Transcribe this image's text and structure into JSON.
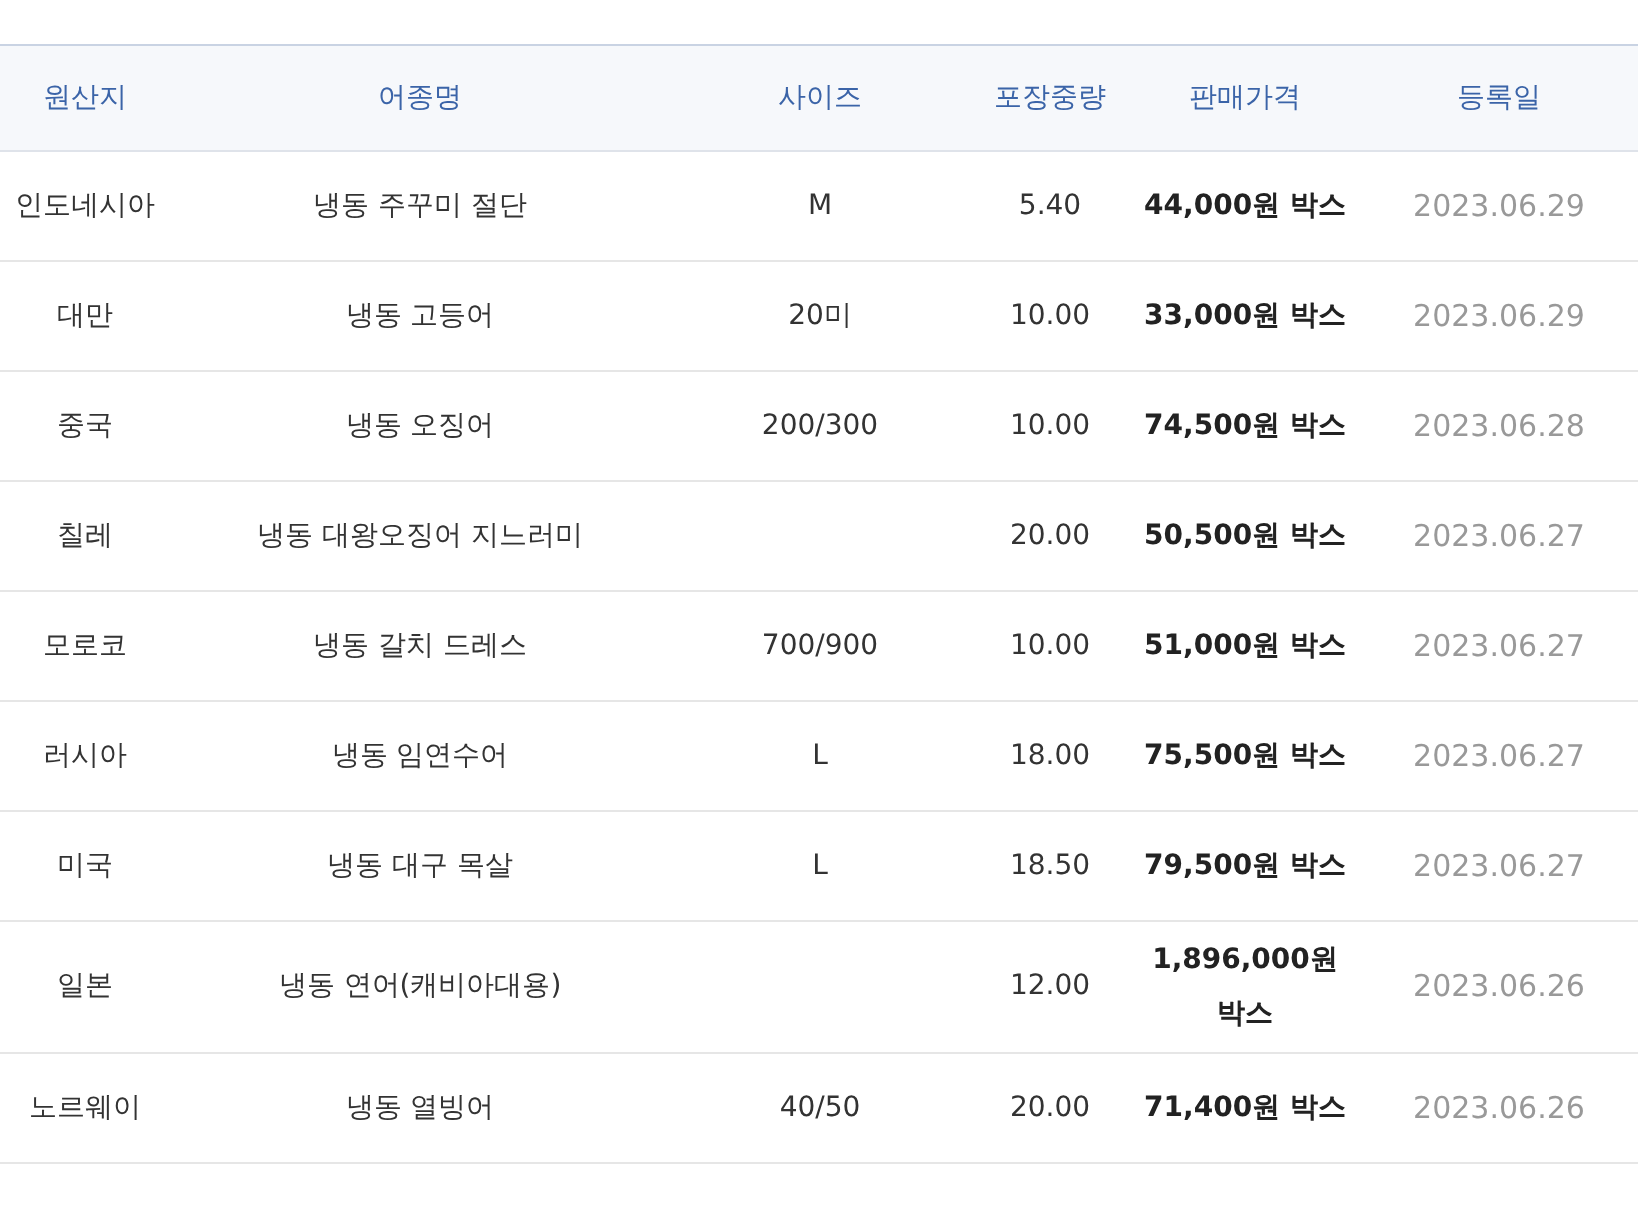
{
  "table": {
    "columns": [
      "원산지",
      "어종명",
      "사이즈",
      "포장중량",
      "판매가격",
      "등록일"
    ],
    "rows": [
      {
        "origin": "인도네시아",
        "name": "냉동 주꾸미 절단",
        "size": "M",
        "weight": "5.40",
        "price": "44,000원 박스",
        "date": "2023.06.29"
      },
      {
        "origin": "대만",
        "name": "냉동 고등어",
        "size": "20미",
        "weight": "10.00",
        "price": "33,000원 박스",
        "date": "2023.06.29"
      },
      {
        "origin": "중국",
        "name": "냉동 오징어",
        "size": "200/300",
        "weight": "10.00",
        "price": "74,500원 박스",
        "date": "2023.06.28"
      },
      {
        "origin": "칠레",
        "name": "냉동 대왕오징어 지느러미",
        "weight": "20.00",
        "price": "50,500원 박스",
        "date": "2023.06.27"
      },
      {
        "origin": "모로코",
        "name": "냉동 갈치 드레스",
        "size": "700/900",
        "weight": "10.00",
        "price": "51,000원 박스",
        "date": "2023.06.27"
      },
      {
        "origin": "러시아",
        "name": "냉동 임연수어",
        "size": "L",
        "weight": "18.00",
        "price": "75,500원 박스",
        "date": "2023.06.27"
      },
      {
        "origin": "미국",
        "name": "냉동 대구 목살",
        "size": "L",
        "weight": "18.50",
        "price": "79,500원 박스",
        "date": "2023.06.27"
      },
      {
        "origin": "일본",
        "name": "냉동 연어(캐비아대용)",
        "weight": "12.00",
        "price": "1,896,000원 박스",
        "date": "2023.06.26"
      },
      {
        "origin": "노르웨이",
        "name": "냉동 열빙어",
        "size": "40/50",
        "weight": "20.00",
        "price": "71,400원 박스",
        "date": "2023.06.26"
      }
    ]
  }
}
